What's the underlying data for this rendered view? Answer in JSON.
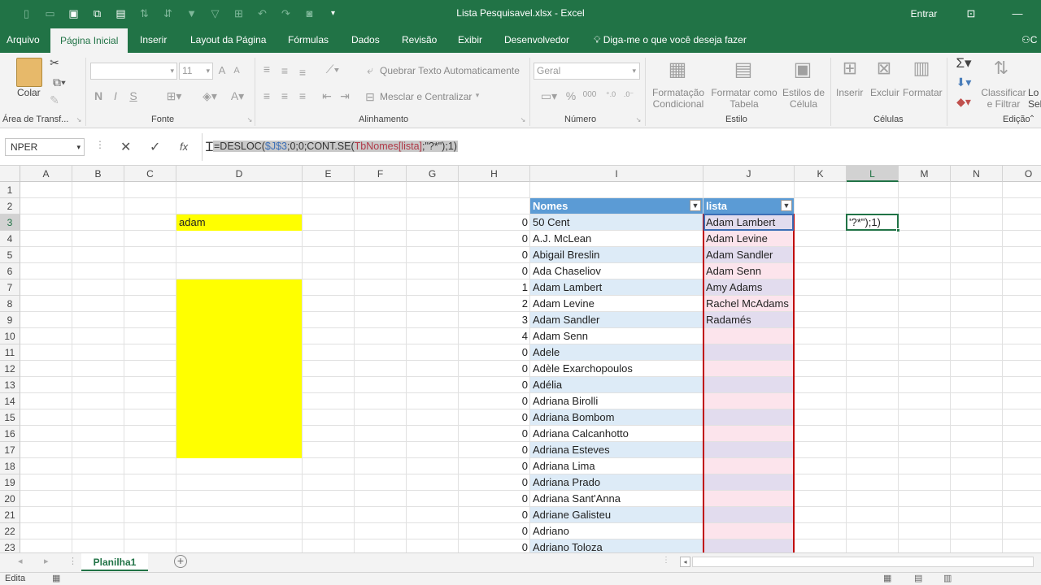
{
  "window": {
    "title": "Lista Pesquisavel.xlsx  -  Excel",
    "signin": "Entrar"
  },
  "colors": {
    "brand": "#217346",
    "table_header": "#5b9bd5",
    "band_blue": "#ddebf7",
    "band_pink": "#fce4ec",
    "highlight": "#ffff00",
    "spill_border": "#c00000"
  },
  "tabs": [
    {
      "label": "Arquivo"
    },
    {
      "label": "Página Inicial"
    },
    {
      "label": "Inserir"
    },
    {
      "label": "Layout da Página"
    },
    {
      "label": "Fórmulas"
    },
    {
      "label": "Dados"
    },
    {
      "label": "Revisão"
    },
    {
      "label": "Exibir"
    },
    {
      "label": "Desenvolvedor"
    },
    {
      "label": "Diga-me o que você deseja fazer"
    }
  ],
  "ribbon": {
    "clipboard": {
      "paste": "Colar",
      "group": "Área de Transf..."
    },
    "font": {
      "size": "11",
      "bold": "N",
      "italic": "I",
      "underline": "S",
      "group": "Fonte"
    },
    "alignment": {
      "wrap": "Quebrar Texto Automaticamente",
      "merge": "Mesclar e Centralizar",
      "group": "Alinhamento"
    },
    "number": {
      "format": "Geral",
      "group": "Número"
    },
    "styles": {
      "conditional": [
        "Formatação",
        "Condicional"
      ],
      "table": [
        "Formatar como",
        "Tabela"
      ],
      "cell": [
        "Estilos de",
        "Célula"
      ],
      "group": "Estilo"
    },
    "cells": {
      "insert": "Inserir",
      "delete": "Excluir",
      "format": "Formatar",
      "group": "Células"
    },
    "editing": {
      "sort": [
        "Classificar",
        "e Filtrar"
      ],
      "find": [
        "Lo",
        "Sel"
      ],
      "group": "Edição"
    }
  },
  "formula_bar": {
    "name_box": "NPER",
    "fx": "fx",
    "formula": "=DESLOC($J$3;0;0;CONT.SE(TbNomes[lista];\"?*\");1)"
  },
  "grid": {
    "columns": [
      "A",
      "B",
      "C",
      "D",
      "E",
      "F",
      "G",
      "H",
      "I",
      "J",
      "K",
      "L",
      "M",
      "N",
      "O"
    ],
    "rows": [
      "1",
      "2",
      "3",
      "4",
      "5",
      "6",
      "7",
      "8",
      "9",
      "10",
      "11",
      "12",
      "13",
      "14",
      "15",
      "16",
      "17",
      "18",
      "19",
      "20",
      "21",
      "22",
      "23"
    ],
    "d3_value": "adam",
    "l3_value": "'?*\");1)",
    "header_nomes": "Nomes",
    "header_lista": "lista",
    "h_values": [
      "0",
      "0",
      "0",
      "0",
      "1",
      "2",
      "3",
      "4",
      "0",
      "0",
      "0",
      "0",
      "0",
      "0",
      "0",
      "0",
      "0",
      "0",
      "0",
      "0",
      "0"
    ],
    "nomes": [
      "50 Cent",
      "A.J. McLean",
      "Abigail Breslin",
      "Ada Chaseliov",
      "Adam Lambert",
      "Adam Levine",
      "Adam Sandler",
      "Adam Senn",
      "Adele",
      "Adèle Exarchopoulos",
      "Adélia",
      "Adriana Birolli",
      "Adriana Bombom",
      "Adriana Calcanhotto",
      "Adriana Esteves",
      "Adriana Lima",
      "Adriana Prado",
      "Adriana Sant'Anna",
      "Adriane Galisteu",
      "Adriano",
      "Adriano Toloza"
    ],
    "lista": [
      "Adam Lambert",
      "Adam Levine",
      "Adam Sandler",
      "Adam Senn",
      "Amy Adams",
      "Rachel McAdams",
      "Radamés",
      "",
      "",
      "",
      "",
      "",
      "",
      "",
      "",
      "",
      "",
      "",
      "",
      "",
      ""
    ]
  },
  "sheet": {
    "tab": "Planilha1"
  },
  "status": {
    "mode": "Edita"
  }
}
